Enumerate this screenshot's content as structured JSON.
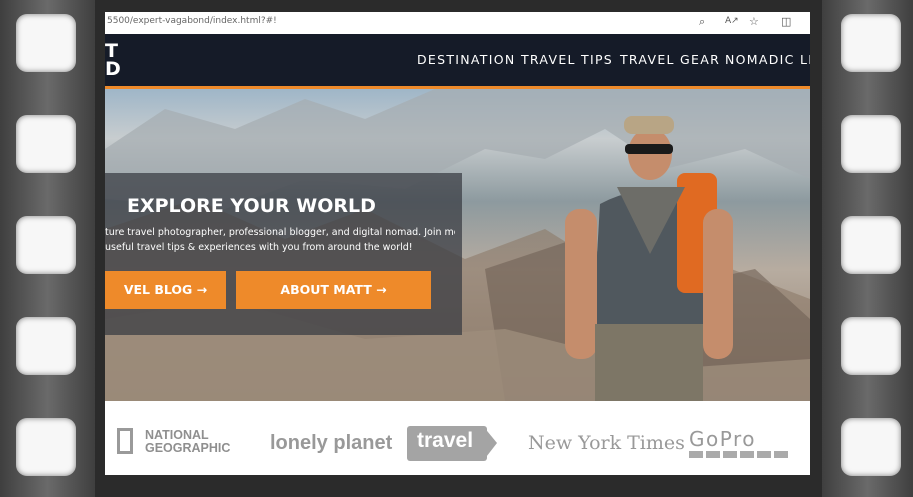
{
  "browser": {
    "url": "5500/expert-vagabond/index.html?#!",
    "icons": [
      "zoom-icon",
      "read-aloud-icon",
      "favorite-star-icon",
      "split-screen-icon"
    ]
  },
  "site": {
    "logo_line1": "T",
    "logo_line2": "D",
    "nav": [
      "DESTINATION",
      "TRAVEL TIPS",
      "TRAVEL GEAR",
      "NOMADIC LIF"
    ]
  },
  "hero": {
    "title": "EXPLORE YOUR WORLD",
    "text_line1": "ture travel photographer, professional blogger, and digital nomad. Join me as I",
    "text_line2": "useful travel tips & experiences with you from around the world!",
    "button_blog": "VEL BLOG →",
    "button_about": "ABOUT MATT →"
  },
  "press": {
    "natgeo_line1": "NATIONAL",
    "natgeo_line2": "GEOGRAPHIC",
    "lonely_planet": "lonely planet",
    "travel_channel": "travel",
    "nyt": "New York Times",
    "gopro": "GoPro"
  },
  "colors": {
    "accent": "#ee8a2a",
    "navbar": "#151b28"
  }
}
